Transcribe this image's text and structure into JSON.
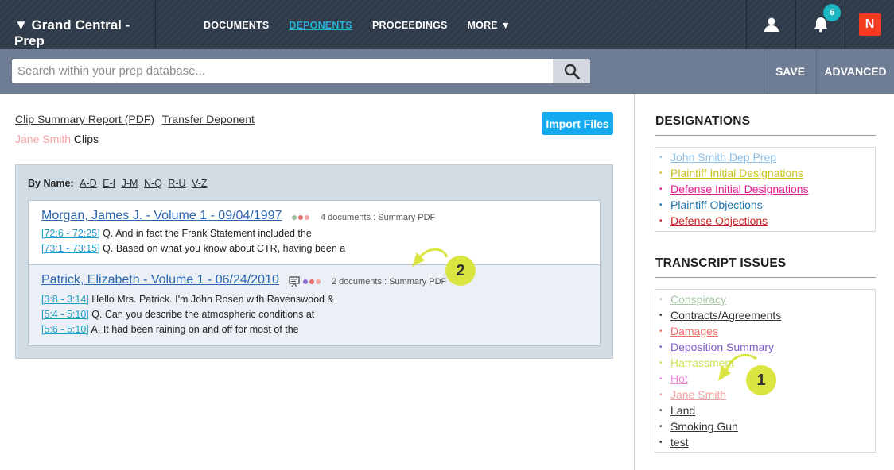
{
  "nav": {
    "brand": "▼ Grand Central - Prep",
    "links": [
      "DOCUMENTS",
      "DEPONENTS",
      "PROCEEDINGS",
      "MORE ▼"
    ],
    "active": "DEPONENTS",
    "notification_count": "6",
    "logo_text": "N"
  },
  "search": {
    "placeholder": "Search within your prep database...",
    "save_label": "SAVE",
    "advanced_label": "ADVANCED"
  },
  "main": {
    "links": [
      "Clip Summary Report (PDF)",
      "Transfer Deponent"
    ],
    "deponent_name": "Jane Smith",
    "clips_label": " Clips",
    "import_label": "Import Files",
    "by_name_label": "By Name:",
    "letter_filters": [
      "A-D",
      "E-I",
      "J-M",
      "N-Q",
      "R-U",
      "V-Z"
    ],
    "cards": [
      {
        "title": "Morgan, James J. - Volume 1 - 09/04/1997",
        "meta": "4 documents : Summary PDF",
        "dot_colors": [
          "#9ac49a",
          "#e86a6a",
          "#f2a4a4"
        ],
        "lines": [
          {
            "ref": "[72:6 - 72:25]",
            "text": " Q. And in fact the Frank Statement included the"
          },
          {
            "ref": "[73:1 - 73:15]",
            "text": " Q. Based on what you know about CTR, having been a"
          }
        ]
      },
      {
        "title": "Patrick, Elizabeth - Volume 1 - 06/24/2010",
        "meta": "2 documents : Summary PDF",
        "dot_colors": [
          "#8f6fd4",
          "#e86a6a",
          "#f2a4a4"
        ],
        "lines": [
          {
            "ref": "[3:8 - 3:14]",
            "text": " Hello Mrs. Patrick. I'm John Rosen with Ravenswood &"
          },
          {
            "ref": "[5:4 - 5:10]",
            "text": " Q. Can you describe the atmospheric conditions at"
          },
          {
            "ref": "[5:6 - 5:10]",
            "text": " A. It had been raining on and off for most of the"
          }
        ]
      }
    ]
  },
  "sidebar": {
    "designations_title": "DESIGNATIONS",
    "designations": [
      {
        "label": "John Smith Dep Prep",
        "color": "#8cc0e8"
      },
      {
        "label": "Plaintiff Initial Designations",
        "color": "#c9c21a"
      },
      {
        "label": "Defense Initial Designations",
        "color": "#e0198f"
      },
      {
        "label": "Plaintiff Objections",
        "color": "#1f70a6"
      },
      {
        "label": "Defense Objections",
        "color": "#c8201e"
      }
    ],
    "issues_title": "TRANSCRIPT ISSUES",
    "issues": [
      {
        "label": "Conspiracy",
        "color": "#a8c7a6"
      },
      {
        "label": "Contracts/Agreements",
        "color": "#333333"
      },
      {
        "label": "Damages",
        "color": "#e8736a"
      },
      {
        "label": "Deposition Summary",
        "color": "#8060c8"
      },
      {
        "label": "Harrassment",
        "color": "#cde25a"
      },
      {
        "label": "Hot",
        "color": "#e68ad8"
      },
      {
        "label": "Jane Smith",
        "color": "#f2a0a0"
      },
      {
        "label": "Land",
        "color": "#333333"
      },
      {
        "label": "Smoking Gun",
        "color": "#333333"
      },
      {
        "label": "test",
        "color": "#333333"
      }
    ]
  },
  "callouts": [
    "1",
    "2"
  ]
}
